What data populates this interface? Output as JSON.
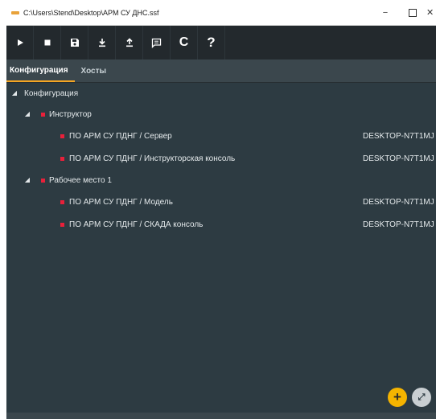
{
  "window": {
    "title": "C:\\Users\\Stend\\Desktop\\АРМ СУ ДНС.ssf",
    "minimize": "−",
    "close": "✕"
  },
  "toolbar": {
    "buttons": [
      {
        "name": "play-icon"
      },
      {
        "name": "stop-icon"
      },
      {
        "name": "save-icon"
      },
      {
        "name": "download-icon"
      },
      {
        "name": "upload-icon"
      },
      {
        "name": "message-icon"
      },
      {
        "name": "refresh-icon",
        "glyph": "C"
      },
      {
        "name": "help-icon",
        "glyph": "?"
      }
    ]
  },
  "tabs": [
    {
      "label": "Конфигурация",
      "active": true
    },
    {
      "label": "Хосты",
      "active": false
    }
  ],
  "tree": {
    "root": {
      "label": "Конфигурация",
      "expander": "◢"
    },
    "groups": [
      {
        "label": "Инструктор",
        "expander": "◢",
        "items": [
          {
            "label": "ПО АРМ СУ ПДНГ / Сервер",
            "host": "DESKTOP-N7T1MJ"
          },
          {
            "label": "ПО АРМ СУ ПДНГ / Инструкторская консоль",
            "host": "DESKTOP-N7T1MJ"
          }
        ]
      },
      {
        "label": "Рабочее место 1",
        "expander": "◢",
        "items": [
          {
            "label": "ПО АРМ СУ ПДНГ / Модель",
            "host": "DESKTOP-N7T1MJ"
          },
          {
            "label": "ПО АРМ СУ ПДНГ / СКАДА консоль",
            "host": "DESKTOP-N7T1MJ"
          }
        ]
      }
    ]
  },
  "fab": {
    "add": "+",
    "expand": "⤢"
  },
  "colors": {
    "accent": "#f5a623",
    "marker": "#e8203a",
    "background": "#2d3b42",
    "toolbar": "#23292d"
  }
}
